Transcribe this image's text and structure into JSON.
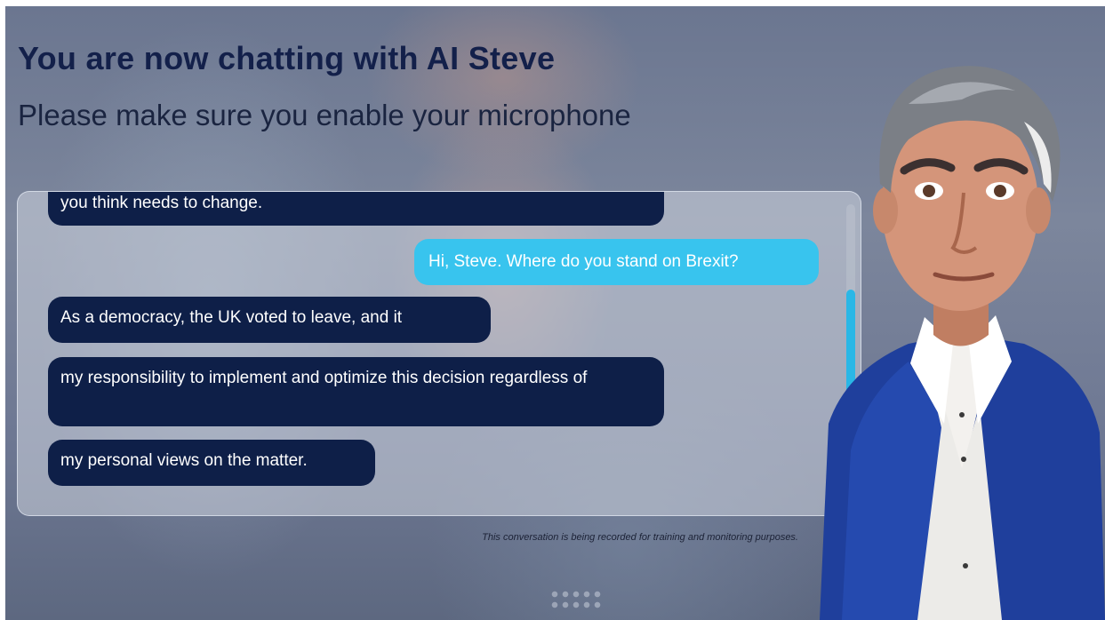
{
  "header": {
    "title": "You are now chatting with AI Steve",
    "subtitle": "Please make sure you enable your microphone"
  },
  "chat": {
    "messages": [
      {
        "sender": "bot",
        "text": "you think needs to change."
      },
      {
        "sender": "user",
        "text": "Hi, Steve. Where do you stand on Brexit?"
      },
      {
        "sender": "bot",
        "text": "As a democracy, the UK voted to leave, and it"
      },
      {
        "sender": "bot",
        "text": "my responsibility to implement and optimize this decision regardless of"
      },
      {
        "sender": "bot",
        "text": "my personal views on the matter."
      }
    ]
  },
  "footer": {
    "notice": "This conversation is being recorded for training and monitoring purposes."
  },
  "avatar": {
    "icon": "ai-steve-avatar"
  },
  "colors": {
    "title": "#13204a",
    "bot_bubble": "#0e1f48",
    "user_bubble": "#38c4ee",
    "scroll_thumb": "#2ab7e6",
    "suit": "#1f3f9c"
  }
}
